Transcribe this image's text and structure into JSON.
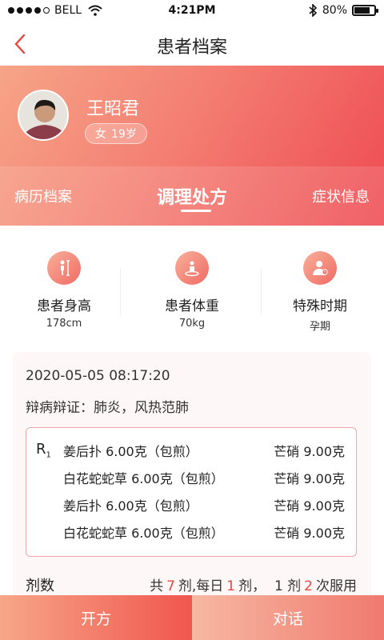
{
  "status_bar": {
    "carrier": "BELL",
    "time": "4:21PM",
    "battery": "80%",
    "battery_level": 0.8
  },
  "nav": {
    "title": "患者档案"
  },
  "patient": {
    "name": "王昭君",
    "gender": "女",
    "age": "19岁"
  },
  "tabs": [
    {
      "label": "病历档案",
      "active": false
    },
    {
      "label": "调理处方",
      "active": true
    },
    {
      "label": "症状信息",
      "active": false
    }
  ],
  "stats": [
    {
      "label": "患者身高",
      "value": "178cm",
      "icon": "height-icon"
    },
    {
      "label": "患者体重",
      "value": "70kg",
      "icon": "weight-icon"
    },
    {
      "label": "特殊时期",
      "value": "孕期",
      "icon": "special-period-icon"
    }
  ],
  "prescription": {
    "time": "2020-05-05 08:17:20",
    "diagnosis": "辩病辩证：肺炎，风热范肺",
    "rx_symbol": "R",
    "rx_sub": "1",
    "herbs": [
      {
        "left": "姜后扑 6.00克（包煎）",
        "right": "芒硝 9.00克"
      },
      {
        "left": "白花蛇蛇草 6.00克（包煎）",
        "right": "芒硝 9.00克"
      },
      {
        "left": "姜后扑 6.00克（包煎）",
        "right": "芒硝 9.00克"
      },
      {
        "left": "白花蛇蛇草 6.00克（包煎）",
        "right": "芒硝 9.00克"
      }
    ],
    "dose": {
      "label": "剂数",
      "p1": "共",
      "n1": "7",
      "p2": "剂,每日",
      "n2": "1",
      "p3": "剂，",
      "p4": "1 剂",
      "n3": "2",
      "p5": "次服用"
    }
  },
  "buttons": {
    "prescribe": "开方",
    "chat": "对话"
  },
  "colors": {
    "accent": "#ee4b52",
    "header_start": "#f6a487",
    "number_red": "#e8463f"
  }
}
